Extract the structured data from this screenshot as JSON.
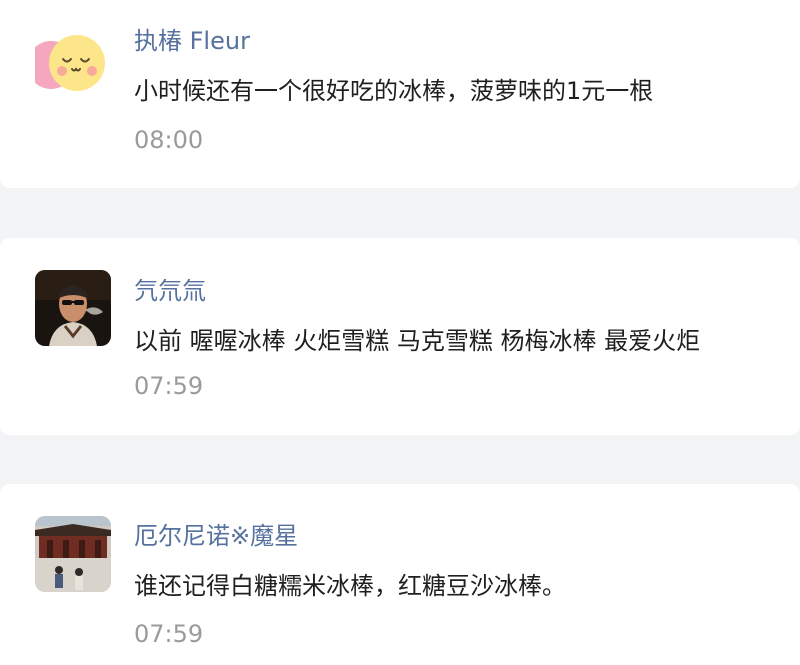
{
  "comments": [
    {
      "username": "执椿 Fleur",
      "text": "小时候还有一个很好吃的冰棒，菠萝味的1元一根",
      "time": "08:00",
      "avatar": "smiling-face-avatar"
    },
    {
      "username": "氕氘氚",
      "text": "以前 喔喔冰棒 火炬雪糕 马克雪糕 杨梅冰棒 最爱火炬",
      "time": "07:59",
      "avatar": "man-sunglasses-avatar"
    },
    {
      "username": "厄尔尼诺※魔星",
      "text": "谁还记得白糖糯米冰棒，红糖豆沙冰棒。",
      "time": "07:59",
      "avatar": "palace-photo-avatar"
    }
  ],
  "colors": {
    "username": "#56719e",
    "text": "#1f1f1f",
    "time": "#9a9a9a",
    "background": "#f3f4f6",
    "card": "#ffffff"
  }
}
